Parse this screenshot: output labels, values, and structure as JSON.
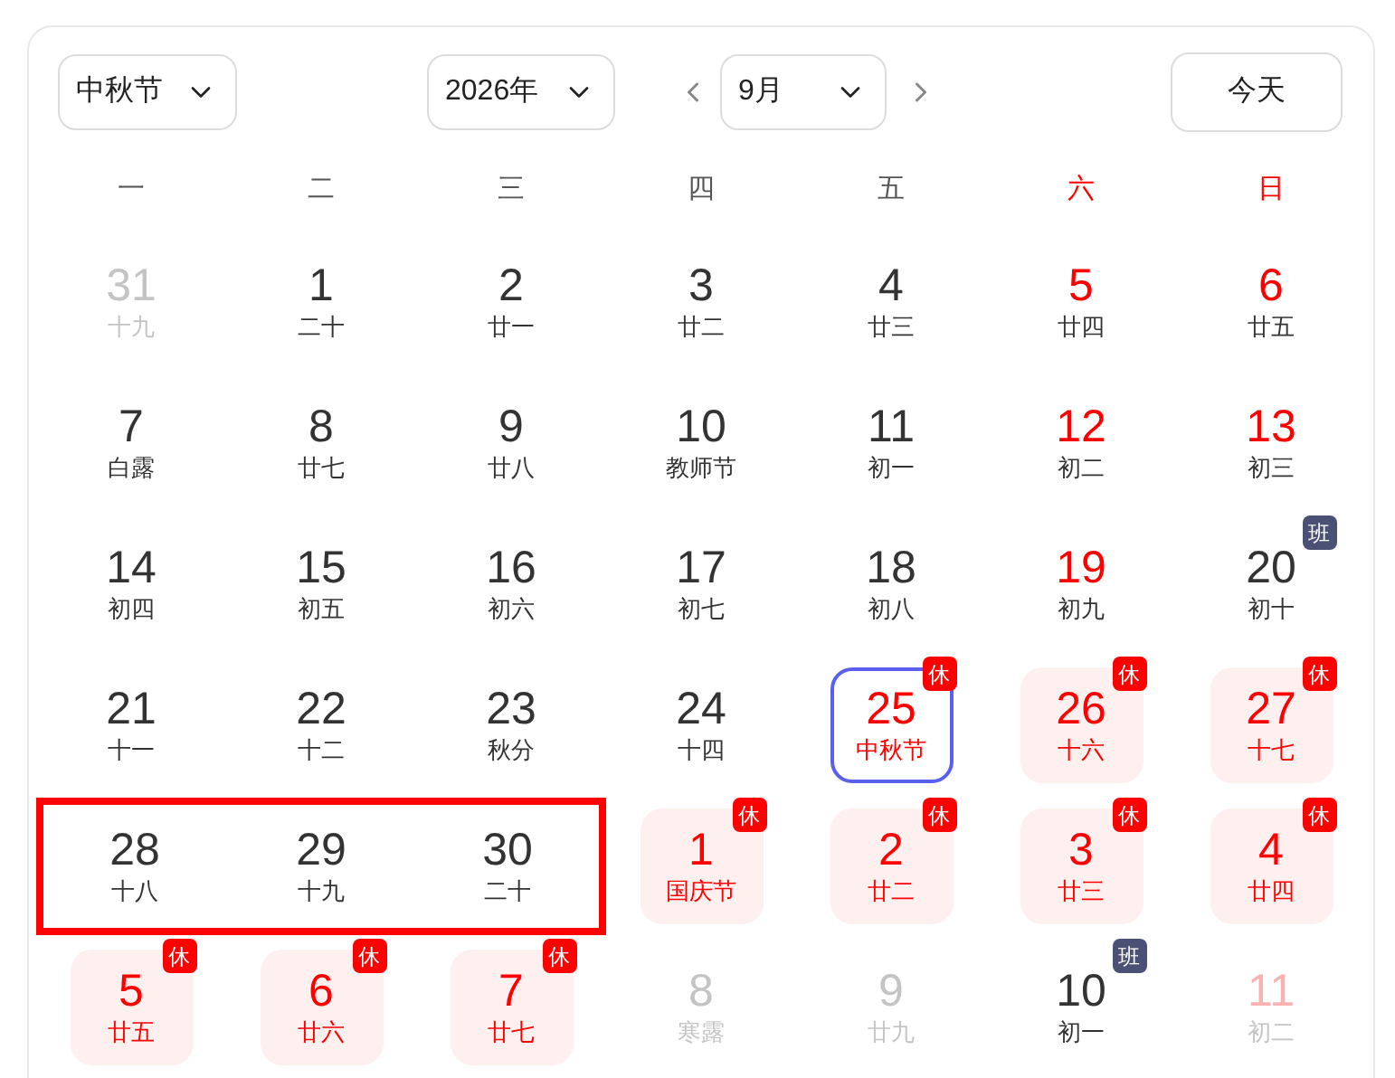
{
  "toolbar": {
    "festival_select": "中秋节",
    "year_select": "2026年",
    "month_select": "9月",
    "today_button": "今天"
  },
  "weekdays": [
    {
      "label": "一",
      "weekend": false
    },
    {
      "label": "二",
      "weekend": false
    },
    {
      "label": "三",
      "weekend": false
    },
    {
      "label": "四",
      "weekend": false
    },
    {
      "label": "五",
      "weekend": false
    },
    {
      "label": "六",
      "weekend": true
    },
    {
      "label": "日",
      "weekend": true
    }
  ],
  "weeks": [
    [
      {
        "day": "31",
        "lunar": "十九",
        "kind": "muted",
        "selected": false,
        "circled": false
      },
      {
        "day": "1",
        "lunar": "二十",
        "kind": "normal",
        "selected": false,
        "circled": false
      },
      {
        "day": "2",
        "lunar": "廿一",
        "kind": "normal",
        "selected": false,
        "circled": false
      },
      {
        "day": "3",
        "lunar": "廿二",
        "kind": "normal",
        "selected": false,
        "circled": false
      },
      {
        "day": "4",
        "lunar": "廿三",
        "kind": "normal",
        "selected": false,
        "circled": false
      },
      {
        "day": "5",
        "lunar": "廿四",
        "kind": "weekend",
        "selected": false,
        "circled": false
      },
      {
        "day": "6",
        "lunar": "廿五",
        "kind": "weekend",
        "selected": false,
        "circled": false
      }
    ],
    [
      {
        "day": "7",
        "lunar": "白露",
        "kind": "normal",
        "selected": false,
        "circled": false
      },
      {
        "day": "8",
        "lunar": "廿七",
        "kind": "normal",
        "selected": false,
        "circled": false
      },
      {
        "day": "9",
        "lunar": "廿八",
        "kind": "normal",
        "selected": false,
        "circled": false
      },
      {
        "day": "10",
        "lunar": "教师节",
        "kind": "normal",
        "selected": false,
        "circled": false
      },
      {
        "day": "11",
        "lunar": "初一",
        "kind": "normal",
        "selected": false,
        "circled": false
      },
      {
        "day": "12",
        "lunar": "初二",
        "kind": "weekend",
        "selected": false,
        "circled": false
      },
      {
        "day": "13",
        "lunar": "初三",
        "kind": "weekend",
        "selected": false,
        "circled": false
      }
    ],
    [
      {
        "day": "14",
        "lunar": "初四",
        "kind": "normal",
        "selected": false,
        "circled": false
      },
      {
        "day": "15",
        "lunar": "初五",
        "kind": "normal",
        "selected": false,
        "circled": false
      },
      {
        "day": "16",
        "lunar": "初六",
        "kind": "normal",
        "selected": false,
        "circled": false
      },
      {
        "day": "17",
        "lunar": "初七",
        "kind": "normal",
        "selected": false,
        "circled": false
      },
      {
        "day": "18",
        "lunar": "初八",
        "kind": "normal",
        "selected": false,
        "circled": false
      },
      {
        "day": "19",
        "lunar": "初九",
        "kind": "weekend",
        "selected": false,
        "circled": false
      },
      {
        "day": "20",
        "lunar": "初十",
        "kind": "normal",
        "selected": false,
        "circled": false,
        "badge": {
          "text": "班",
          "kind": "work"
        }
      }
    ],
    [
      {
        "day": "21",
        "lunar": "十一",
        "kind": "normal",
        "selected": false,
        "circled": false
      },
      {
        "day": "22",
        "lunar": "十二",
        "kind": "normal",
        "selected": false,
        "circled": false
      },
      {
        "day": "23",
        "lunar": "秋分",
        "kind": "normal",
        "selected": false,
        "circled": false
      },
      {
        "day": "24",
        "lunar": "十四",
        "kind": "normal",
        "selected": false,
        "circled": false
      },
      {
        "day": "25",
        "lunar": "中秋节",
        "kind": "holiday",
        "selected": true,
        "circled": false,
        "badge": {
          "text": "休",
          "kind": "rest"
        }
      },
      {
        "day": "26",
        "lunar": "十六",
        "kind": "holiday",
        "selected": false,
        "circled": false,
        "badge": {
          "text": "休",
          "kind": "rest"
        }
      },
      {
        "day": "27",
        "lunar": "十七",
        "kind": "holiday",
        "selected": false,
        "circled": false,
        "badge": {
          "text": "休",
          "kind": "rest"
        }
      }
    ],
    [
      {
        "day": "28",
        "lunar": "十八",
        "kind": "normal",
        "selected": false,
        "circled": true
      },
      {
        "day": "29",
        "lunar": "十九",
        "kind": "normal",
        "selected": false,
        "circled": true
      },
      {
        "day": "30",
        "lunar": "二十",
        "kind": "normal",
        "selected": false,
        "circled": true
      },
      {
        "day": "1",
        "lunar": "国庆节",
        "kind": "holiday",
        "selected": false,
        "circled": false,
        "badge": {
          "text": "休",
          "kind": "rest"
        }
      },
      {
        "day": "2",
        "lunar": "廿二",
        "kind": "holiday",
        "selected": false,
        "circled": false,
        "badge": {
          "text": "休",
          "kind": "rest"
        }
      },
      {
        "day": "3",
        "lunar": "廿三",
        "kind": "holiday",
        "selected": false,
        "circled": false,
        "badge": {
          "text": "休",
          "kind": "rest"
        }
      },
      {
        "day": "4",
        "lunar": "廿四",
        "kind": "holiday",
        "selected": false,
        "circled": false,
        "badge": {
          "text": "休",
          "kind": "rest"
        }
      }
    ],
    [
      {
        "day": "5",
        "lunar": "廿五",
        "kind": "holiday",
        "selected": false,
        "circled": false,
        "badge": {
          "text": "休",
          "kind": "rest"
        }
      },
      {
        "day": "6",
        "lunar": "廿六",
        "kind": "holiday",
        "selected": false,
        "circled": false,
        "badge": {
          "text": "休",
          "kind": "rest"
        }
      },
      {
        "day": "7",
        "lunar": "廿七",
        "kind": "holiday",
        "selected": false,
        "circled": false,
        "badge": {
          "text": "休",
          "kind": "rest"
        }
      },
      {
        "day": "8",
        "lunar": "寒露",
        "kind": "muted",
        "selected": false,
        "circled": false
      },
      {
        "day": "9",
        "lunar": "廿九",
        "kind": "muted",
        "selected": false,
        "circled": false
      },
      {
        "day": "10",
        "lunar": "初一",
        "kind": "normal",
        "selected": false,
        "circled": false,
        "badge": {
          "text": "班",
          "kind": "work"
        }
      },
      {
        "day": "11",
        "lunar": "初二",
        "kind": "muted_weekend",
        "selected": false,
        "circled": false
      }
    ]
  ]
}
